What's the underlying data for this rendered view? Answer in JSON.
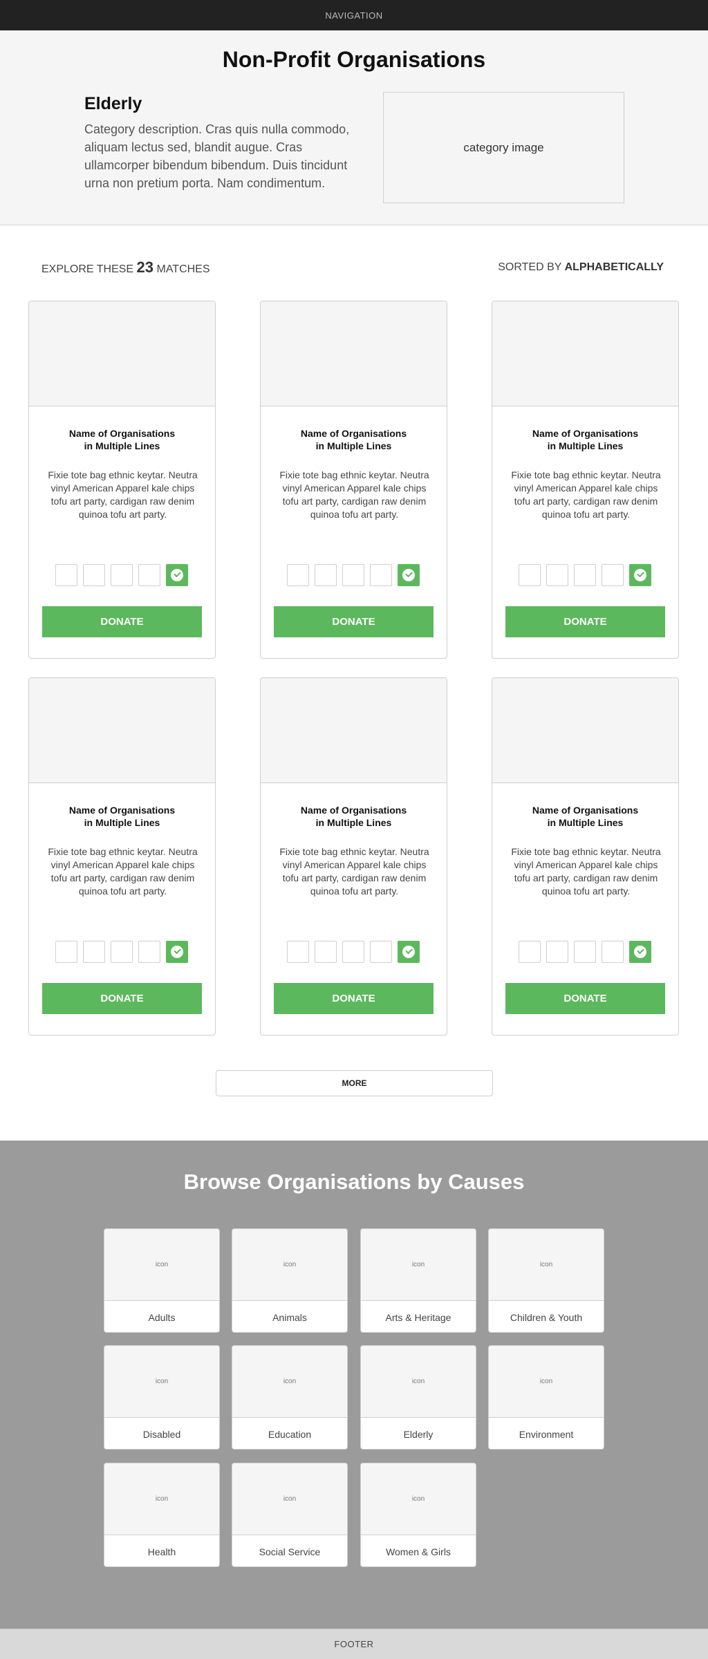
{
  "nav": {
    "label": "NAVIGATION"
  },
  "hero": {
    "title": "Non-Profit Organisations",
    "category": "Elderly",
    "description": "Category description. Cras quis nulla commodo, aliquam lectus sed, blandit augue. Cras ullamcorper bibendum bibendum. Duis tincidunt urna non pretium porta. Nam condimentum.",
    "image_label": "category image"
  },
  "results": {
    "explore_prefix": "EXPLORE THESE",
    "count": "23",
    "explore_suffix": "MATCHES",
    "sorted_prefix": "SORTED BY",
    "sorted_value": "ALPHABETICALLY"
  },
  "cards": [
    {
      "name_line1": "Name of Organisations",
      "name_line2": "in Multiple Lines",
      "description": "Fixie tote bag ethnic keytar. Neutra vinyl American Apparel kale chips tofu art party, cardigan raw denim quinoa tofu art party.",
      "donate": "DONATE"
    },
    {
      "name_line1": "Name of Organisations",
      "name_line2": "in Multiple Lines",
      "description": "Fixie tote bag ethnic keytar. Neutra vinyl American Apparel kale chips tofu art party, cardigan raw denim quinoa tofu art party.",
      "donate": "DONATE"
    },
    {
      "name_line1": "Name of Organisations",
      "name_line2": "in Multiple Lines",
      "description": "Fixie tote bag ethnic keytar. Neutra vinyl American Apparel kale chips tofu art party, cardigan raw denim quinoa tofu art party.",
      "donate": "DONATE"
    },
    {
      "name_line1": "Name of Organisations",
      "name_line2": "in Multiple Lines",
      "description": "Fixie tote bag ethnic keytar. Neutra vinyl American Apparel kale chips tofu art party, cardigan raw denim quinoa tofu art party.",
      "donate": "DONATE"
    },
    {
      "name_line1": "Name of Organisations",
      "name_line2": "in Multiple Lines",
      "description": "Fixie tote bag ethnic keytar. Neutra vinyl American Apparel kale chips tofu art party, cardigan raw denim quinoa tofu art party.",
      "donate": "DONATE"
    },
    {
      "name_line1": "Name of Organisations",
      "name_line2": "in Multiple Lines",
      "description": "Fixie tote bag ethnic keytar. Neutra vinyl American Apparel kale chips tofu art party, cardigan raw denim quinoa tofu art party.",
      "donate": "DONATE"
    }
  ],
  "more_label": "MORE",
  "causes": {
    "title": "Browse Organisations by Causes",
    "icon_label": "icon",
    "items": [
      "Adults",
      "Animals",
      "Arts & Heritage",
      "Children & Youth",
      "Disabled",
      "Education",
      "Elderly",
      "Environment",
      "Health",
      "Social Service",
      "Women & Girls"
    ]
  },
  "footer": {
    "label": "FOOTER"
  },
  "colors": {
    "accent": "#5cb85c",
    "nav_bg": "#222222",
    "causes_bg": "#9b9b9b"
  },
  "icons": {
    "check": "check-circle-icon"
  }
}
